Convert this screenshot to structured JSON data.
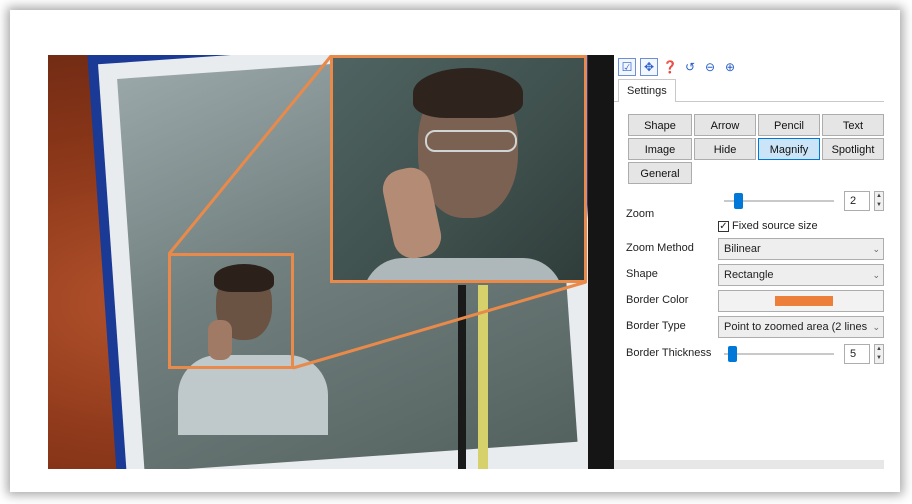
{
  "toolbar": {
    "icons": [
      "checkbox-icon",
      "select-tool-icon",
      "help-icon",
      "undo-icon",
      "back-icon",
      "forward-icon"
    ]
  },
  "tabs": [
    {
      "label": "Settings",
      "active": true
    }
  ],
  "tools": {
    "shape": "Shape",
    "arrow": "Arrow",
    "pencil": "Pencil",
    "text": "Text",
    "image": "Image",
    "hide": "Hide",
    "magnify": "Magnify",
    "spotlight": "Spotlight",
    "general": "General",
    "active": "Magnify"
  },
  "settings": {
    "zoom_label": "Zoom",
    "zoom_value": "2",
    "zoom_level_fraction": 0.1,
    "fixed_source_label": "Fixed source size",
    "fixed_source_checked": true,
    "fixed_source_mark": "✓",
    "zoom_method_label": "Zoom Method",
    "zoom_method_value": "Bilinear",
    "shape_label": "Shape",
    "shape_value": "Rectangle",
    "border_color_label": "Border Color",
    "border_color": "#ec7f3a",
    "border_type_label": "Border Type",
    "border_type_value": "Point to zoomed area (2 lines",
    "border_thickness_label": "Border Thickness",
    "border_thickness_value": "5",
    "border_thickness_fraction": 0.04,
    "chevron": "⌄",
    "spin_up": "▲",
    "spin_down": "▼"
  },
  "colors": {
    "accent": "#0078d7",
    "magnify_border": "#e98a4a"
  }
}
